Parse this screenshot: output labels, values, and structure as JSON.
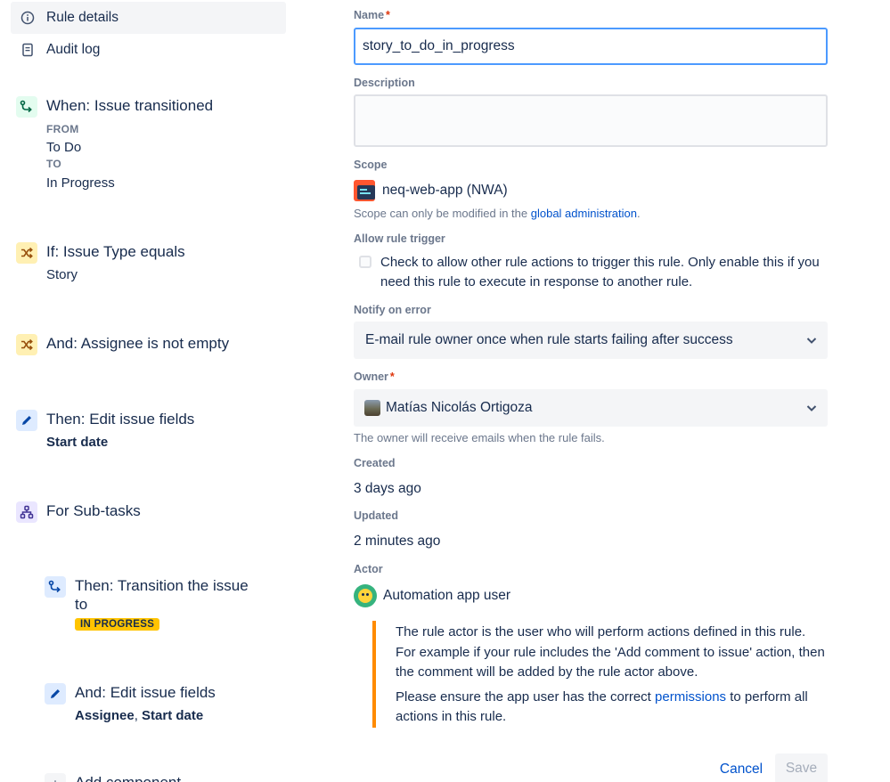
{
  "sidebar": {
    "nav": [
      {
        "label": "Rule details",
        "icon": "info-icon",
        "active": true
      },
      {
        "label": "Audit log",
        "icon": "document-icon",
        "active": false
      }
    ],
    "components": {
      "trigger": {
        "title": "When: Issue transitioned",
        "from_caption": "FROM",
        "from_value": "To Do",
        "to_caption": "TO",
        "to_value": "In Progress",
        "icon": "transition-icon"
      },
      "condition1": {
        "title": "If: Issue Type equals",
        "value": "Story",
        "icon": "shuffle-icon"
      },
      "condition2": {
        "title": "And: Assignee is not empty",
        "icon": "shuffle-icon"
      },
      "action1": {
        "title": "Then: Edit issue fields",
        "value": "Start date",
        "icon": "pencil-icon"
      },
      "branch": {
        "title": "For Sub-tasks",
        "icon": "hierarchy-icon"
      },
      "action2": {
        "title_line1": "Then: Transition the issue",
        "title_line2": "to",
        "status": "IN PROGRESS",
        "icon": "transition-icon"
      },
      "action3": {
        "title": "And: Edit issue fields",
        "value_a": "Assignee",
        "separator": ", ",
        "value_b": "Start date",
        "icon": "pencil-icon"
      },
      "add_component": {
        "label": "Add component"
      }
    }
  },
  "form": {
    "name_label": "Name",
    "required_mark": "*",
    "name_value": "story_to_do_in_progress",
    "description_label": "Description",
    "description_value": "",
    "scope_label": "Scope",
    "scope_value": "neq-web-app (NWA)",
    "scope_help_prefix": "Scope can only be modified in the ",
    "scope_help_link": "global administration",
    "scope_help_suffix": ".",
    "trigger_label": "Allow rule trigger",
    "trigger_checkbox_text": "Check to allow other rule actions to trigger this rule. Only enable this if you need this rule to execute in response to another rule.",
    "trigger_checked": false,
    "notify_label": "Notify on error",
    "notify_value": "E-mail rule owner once when rule starts failing after success",
    "owner_label": "Owner",
    "owner_value": "Matías Nicolás Ortigoza",
    "owner_help": "The owner will receive emails when the rule fails.",
    "created_label": "Created",
    "created_value": "3 days ago",
    "updated_label": "Updated",
    "updated_value": "2 minutes ago",
    "actor_label": "Actor",
    "actor_value": "Automation app user",
    "actor_note_p1": "The rule actor is the user who will perform actions defined in this rule. For example if your rule includes the 'Add comment to issue' action, then the comment will be added by the rule actor above.",
    "actor_note_p2_prefix": "Please ensure the app user has the correct ",
    "actor_note_p2_link": "permissions",
    "actor_note_p2_suffix": " to perform all actions in this rule.",
    "cancel_label": "Cancel",
    "save_label": "Save"
  },
  "colors": {
    "accent": "#0052cc",
    "focus_border": "#4c9aff",
    "required": "#de350b",
    "status_lozenge": "#ffc400",
    "note_border": "#ff8b00"
  }
}
